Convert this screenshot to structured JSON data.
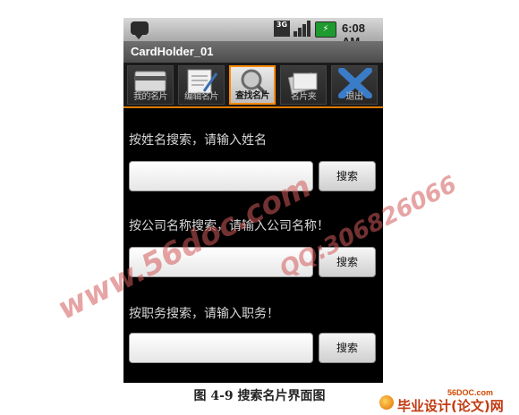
{
  "status_bar": {
    "time": "6:08 AM",
    "network": "3G"
  },
  "app": {
    "title": "CardHolder_01"
  },
  "tabs": [
    {
      "label": "我的名片",
      "icon": "card-icon",
      "selected": false
    },
    {
      "label": "编辑名片",
      "icon": "edit-icon",
      "selected": false
    },
    {
      "label": "查找名片",
      "icon": "magnifier-icon",
      "selected": true
    },
    {
      "label": "名片夹",
      "icon": "cards-icon",
      "selected": false
    },
    {
      "label": "退出",
      "icon": "close-icon",
      "selected": false
    }
  ],
  "search": {
    "name_label": "按姓名搜索，请输入姓名",
    "company_label": "按公司名称搜索，请输入公司名称！",
    "position_label": "按职务搜索，请输入职务！",
    "button_label": "搜索",
    "name_value": "",
    "company_value": "",
    "position_value": ""
  },
  "caption": "图 4-9 搜索名片界面图",
  "watermarks": {
    "site": "www.56doc.com",
    "qq": "QQ:306826066"
  },
  "logo": {
    "domain": "56DOC.com",
    "text": "毕业设计(论文)网"
  },
  "colors": {
    "accent": "#e07a00",
    "watermark": "#d25a5a"
  }
}
